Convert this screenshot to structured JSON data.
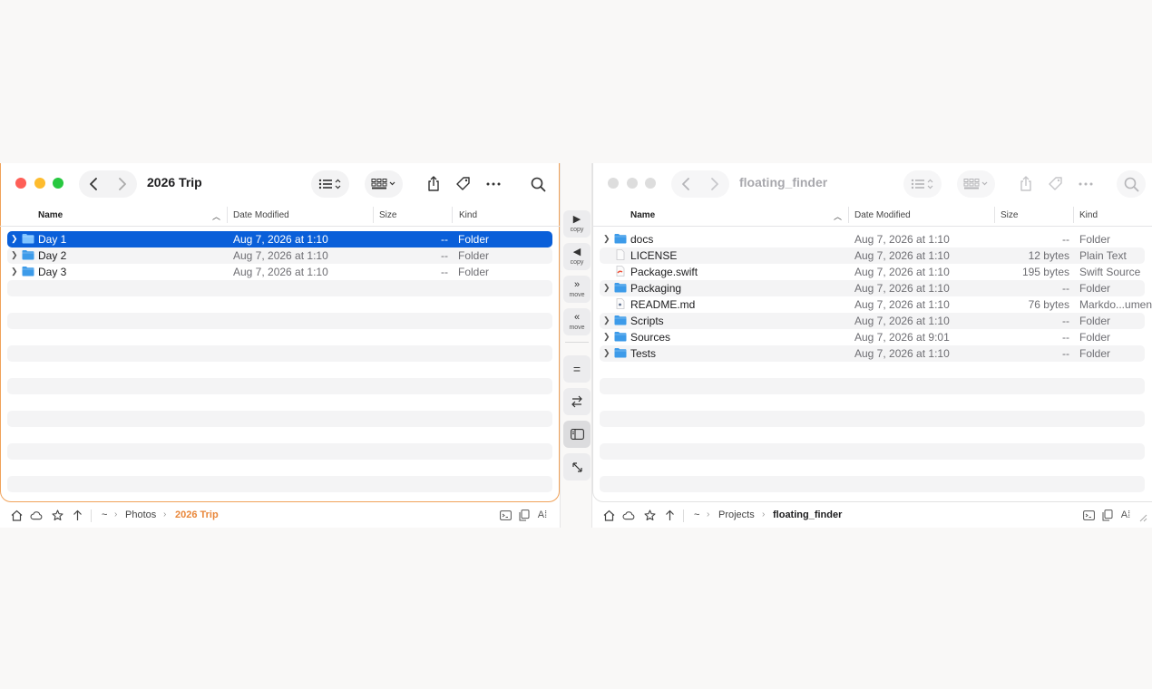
{
  "left": {
    "title": "2026 Trip",
    "columns": {
      "name": "Name",
      "date": "Date Modified",
      "size": "Size",
      "kind": "Kind"
    },
    "files": [
      {
        "name": "Day 1",
        "date": "Aug 7, 2026 at 1:10",
        "size": "--",
        "kind": "Folder",
        "type": "folder",
        "selected": true
      },
      {
        "name": "Day 2",
        "date": "Aug 7, 2026 at 1:10",
        "size": "--",
        "kind": "Folder",
        "type": "folder"
      },
      {
        "name": "Day 3",
        "date": "Aug 7, 2026 at 1:10",
        "size": "--",
        "kind": "Folder",
        "type": "folder"
      }
    ],
    "path": [
      "~",
      "Photos",
      "2026 Trip"
    ]
  },
  "right": {
    "title": "floating_finder",
    "columns": {
      "name": "Name",
      "date": "Date Modified",
      "size": "Size",
      "kind": "Kind"
    },
    "files": [
      {
        "name": "docs",
        "date": "Aug 7, 2026 at 1:10",
        "size": "--",
        "kind": "Folder",
        "type": "folder"
      },
      {
        "name": "LICENSE",
        "date": "Aug 7, 2026 at 1:10",
        "size": "12 bytes",
        "kind": "Plain Text",
        "type": "text"
      },
      {
        "name": "Package.swift",
        "date": "Aug 7, 2026 at 1:10",
        "size": "195 bytes",
        "kind": "Swift Source",
        "type": "swift"
      },
      {
        "name": "Packaging",
        "date": "Aug 7, 2026 at 1:10",
        "size": "--",
        "kind": "Folder",
        "type": "folder"
      },
      {
        "name": "README.md",
        "date": "Aug 7, 2026 at 1:10",
        "size": "76 bytes",
        "kind": "Markdo...ument",
        "type": "markdown"
      },
      {
        "name": "Scripts",
        "date": "Aug 7, 2026 at 1:10",
        "size": "--",
        "kind": "Folder",
        "type": "folder"
      },
      {
        "name": "Sources",
        "date": "Aug 7, 2026 at 9:01",
        "size": "--",
        "kind": "Folder",
        "type": "folder"
      },
      {
        "name": "Tests",
        "date": "Aug 7, 2026 at 1:10",
        "size": "--",
        "kind": "Folder",
        "type": "folder"
      }
    ],
    "path": [
      "~",
      "Projects",
      "floating_finder"
    ]
  },
  "middle": {
    "copy_right_label": "copy",
    "copy_left_label": "copy",
    "move_right_label": "move",
    "move_left_label": "move",
    "equal_label": "="
  },
  "colors": {
    "selection": "#0a5fd9",
    "active_accent": "#e9873a",
    "folder": "#3d9be9",
    "close": "#fe5f57",
    "minimize": "#febc2e",
    "zoom": "#28c840",
    "inactive_light": "#dddddd"
  },
  "icons": [
    "chevron-left-icon",
    "chevron-right-icon",
    "list-view-icon",
    "grid-view-icon",
    "share-icon",
    "tag-icon",
    "more-icon",
    "search-icon",
    "home-icon",
    "cloud-icon",
    "star-icon",
    "arrow-up-icon",
    "terminal-icon",
    "copy-path-icon",
    "text-size-icon"
  ]
}
